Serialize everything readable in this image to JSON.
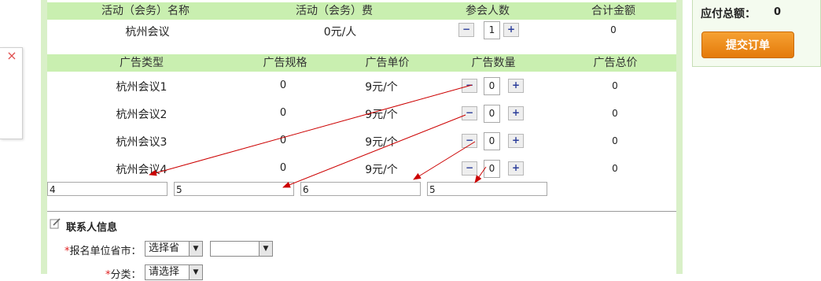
{
  "activity": {
    "headers": [
      "活动（会务）名称",
      "活动（会务）费",
      "参会人数",
      "合计金额"
    ],
    "row": {
      "name": "杭州会议",
      "fee": "0元/人",
      "count": "1",
      "total": "0"
    }
  },
  "ads": {
    "headers": [
      "广告类型",
      "广告规格",
      "广告单价",
      "广告数量",
      "广告总价"
    ],
    "rows": [
      {
        "type": "杭州会议1",
        "spec": "0",
        "price": "9元/个",
        "qty": "0",
        "total": "0"
      },
      {
        "type": "杭州会议2",
        "spec": "0",
        "price": "9元/个",
        "qty": "0",
        "total": "0"
      },
      {
        "type": "杭州会议3",
        "spec": "0",
        "price": "9元/个",
        "qty": "0",
        "total": "0"
      },
      {
        "type": "杭州会议4",
        "spec": "0",
        "price": "9元/个",
        "qty": "0",
        "total": "0"
      }
    ]
  },
  "stepper": {
    "minus": "−",
    "plus": "+"
  },
  "inputs": [
    "4",
    "5",
    "6",
    "5"
  ],
  "summary": {
    "total_label": "应付总额：",
    "total_value": "0",
    "submit_label": "提交订单"
  },
  "contact": {
    "section_title": "联系人信息",
    "province_label": "报名单位省市：",
    "province_value": "选择省",
    "city_value": "",
    "category_label": "分类：",
    "category_value": "请选择",
    "required_mark": "*"
  },
  "icons": {
    "close": "×",
    "dropdown": "▼",
    "edit": "edit-icon"
  },
  "colors": {
    "header_bg": "#c9efb0",
    "submit_bg": "#e47a0a",
    "arrow": "#cc0000"
  }
}
